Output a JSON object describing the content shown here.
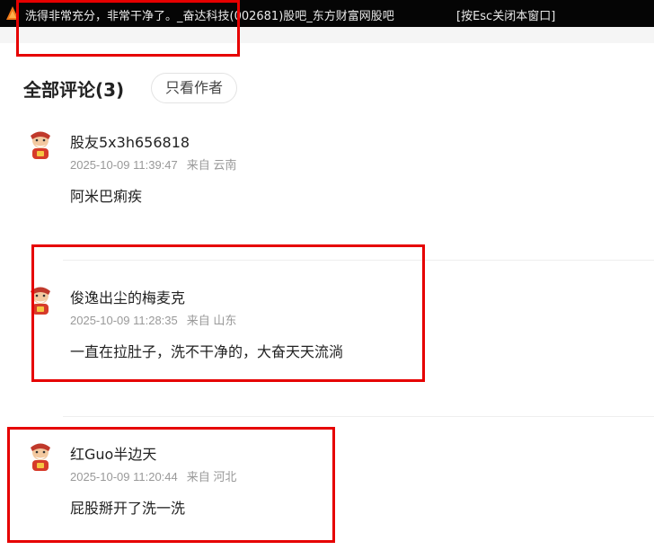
{
  "window": {
    "title": "洗得非常充分，非常干净了。_奋达科技(002681)股吧_东方财富网股吧",
    "hint": "[按Esc关闭本窗口]",
    "icon_name": "app-logo-icon"
  },
  "comments_header": {
    "title": "全部评论(3)",
    "author_only_label": "只看作者"
  },
  "comments": [
    {
      "username": "股友5x3h656818",
      "time": "2025-10-09 11:39:47",
      "location": "来自 云南",
      "text": "阿米巴痢疾"
    },
    {
      "username": "俊逸出尘的梅麦克",
      "time": "2025-10-09 11:28:35",
      "location": "来自 山东",
      "text": "一直在拉肚子，洗不干净的，大奋天天流淌"
    },
    {
      "username": "红Guo半边天",
      "time": "2025-10-09 11:20:44",
      "location": "来自 河北",
      "text": "屁股掰开了洗一洗"
    }
  ],
  "colors": {
    "annotation_box": "#e60000",
    "titlebar_bg": "#050505",
    "meta_text": "#999999"
  }
}
